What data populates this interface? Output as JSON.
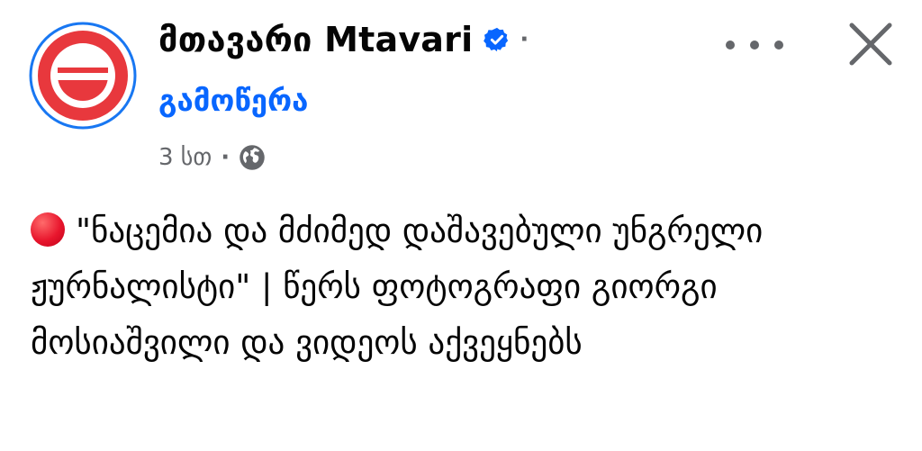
{
  "post": {
    "page_name": "მთავარი Mtavari",
    "follow_label": "გამოწერა",
    "timestamp": "3 სთ",
    "meta_separator": "·",
    "name_separator": "·",
    "privacy_icon": "globe-icon",
    "verified_icon": "verified-badge-icon",
    "avatar_icon": "mtavari-logo",
    "status_emoji": "red-circle",
    "text": "\"ნაცემია და მძიმედ დაშავებული უნგრელი ჟურნალისტი\" | წერს ფოტოგრაფი გიორგი მოსიაშვილი და ვიდეოს აქვეყნებს"
  },
  "colors": {
    "link": "#0866ff",
    "verified": "#0866ff",
    "secondary_text": "#65676b",
    "logo_ring": "#1877f2",
    "logo_red": "#e8383d"
  }
}
